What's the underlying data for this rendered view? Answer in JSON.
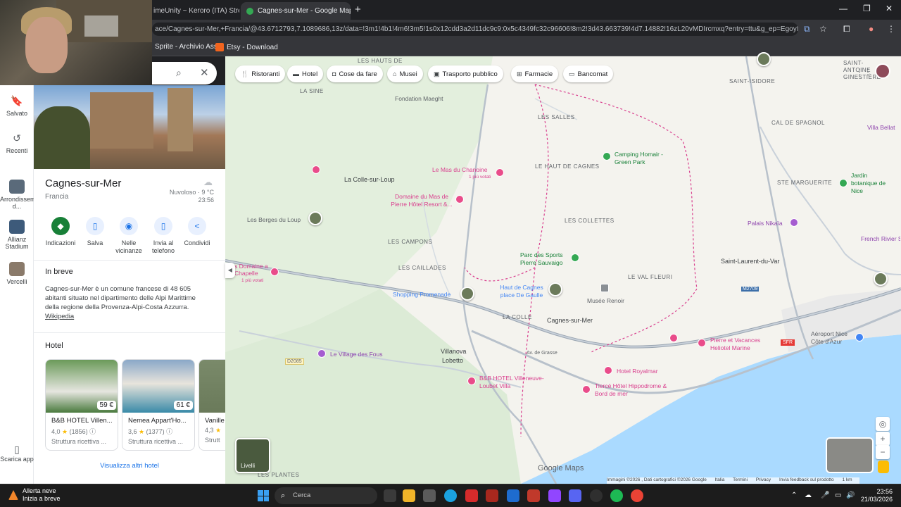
{
  "browser": {
    "tabs": [
      {
        "title": "imeUnity ~ Keroro (ITA) Strea",
        "active": false
      },
      {
        "title": "Cagnes-sur-Mer - Google Maps",
        "active": true
      }
    ],
    "url": "ace/Cagnes-sur-Mer,+Francia/@43.6712793,7.1089686,13z/data=!3m1!4b1!4m6!3m5!1s0x12cdd3a2d11dc9c9:0x5c4349fc32c96606!8m2!3d43.663739!4d7.14882!16zL20vMDIrcmxq?entry=ttu&g_ep=EgoyMDI2MDMxOC4xI...",
    "bookmarks": [
      {
        "label": "Sprite - Archivio Ass...",
        "color": "#4a4a4a"
      },
      {
        "label": "Etsy - Download",
        "color": "#f1641e"
      }
    ]
  },
  "rail": {
    "items": [
      {
        "label": "Salvato",
        "icon": "bookmark-icon"
      },
      {
        "label": "Recenti",
        "icon": "history-icon"
      }
    ],
    "recent_places": [
      {
        "label": "Arrondissement d...",
        "color": "#5a6a7a"
      },
      {
        "label": "Allianz Stadium",
        "color": "#3d5a7a"
      },
      {
        "label": "Vercelli",
        "color": "#8a7a6a"
      }
    ],
    "download": "Scarica app"
  },
  "place": {
    "name": "Cagnes-sur-Mer",
    "country": "Francia",
    "weather": "Nuvoloso · 9 °C",
    "time": "23:56",
    "actions": [
      {
        "label": "Indicazioni",
        "icon": "directions-icon"
      },
      {
        "label": "Salva",
        "icon": "bookmark-icon"
      },
      {
        "label": "Nelle vicinanze",
        "icon": "nearby-icon"
      },
      {
        "label": "Invia al telefono",
        "icon": "phone-icon"
      },
      {
        "label": "Condividi",
        "icon": "share-icon"
      }
    ],
    "brief_title": "In breve",
    "brief_text": "Cagnes-sur-Mer è un comune francese di 48 605 abitanti situato nel dipartimento delle Alpi Marittime della regione della Provenza-Alpi-Costa Azzurra.",
    "brief_link": "Wikipedia",
    "hotels_title": "Hotel",
    "hotels": [
      {
        "name": "B&B HOTEL Villen...",
        "price": "59 €",
        "rating": "4,0",
        "reviews": "(1856)",
        "kind": "Struttura ricettiva ...",
        "color": "#4a7a3e"
      },
      {
        "name": "Nemea Appart'Ho...",
        "price": "61 €",
        "rating": "3,6",
        "reviews": "(1377)",
        "kind": "Struttura ricettiva ...",
        "color": "#3a8aa8"
      },
      {
        "name": "Vanille",
        "price": "",
        "rating": "4,3",
        "reviews": "",
        "kind": "Strutt",
        "color": "#6a7a5a"
      }
    ],
    "more_hotels": "Visualizza altri hotel"
  },
  "map": {
    "chips": [
      {
        "label": "Ristoranti",
        "icon": "restaurant-icon"
      },
      {
        "label": "Hotel",
        "icon": "hotel-icon"
      },
      {
        "label": "Cose da fare",
        "icon": "camera-icon"
      },
      {
        "label": "Musei",
        "icon": "museum-icon"
      },
      {
        "label": "Trasporto pubblico",
        "icon": "transit-icon"
      },
      {
        "label": "Farmacie",
        "icon": "pharmacy-icon"
      },
      {
        "label": "Bancomat",
        "icon": "atm-icon"
      }
    ],
    "labels": {
      "la_colle": "La Colle-sur-Loup",
      "cagnes": "Cagnes-sur-Mer",
      "villanova": "Villanova",
      "lobetto": "Lobetto",
      "saint_laurent": "Saint-Laurent-du-Var",
      "les_salles": "LES SALLES",
      "haut_de_cagnes_area": "LE HAUT DE CAGNES",
      "les_collettes": "LES COLLETTES",
      "les_campons": "LES CAMPONS",
      "les_caillades": "LES CAILLADES",
      "la_colle_area": "LA COLLE",
      "le_val_fleuri": "LE VAL FLEURI",
      "la_sine": "LA SINE",
      "les_hauts": "LES HAUTS DE",
      "cal_de_spagnol": "CAL DE SPAGNOL",
      "ste_marguerite": "STE MARGUERITE",
      "saint_isidore": "SAINT-ISIDORE",
      "saint_antoine": "SAINT-ANTOINE GINESTIÈRE",
      "les_plantes": "LES PLANTES",
      "fondation": "Fondation Maeght",
      "mas_chanoine": "Le Mas du Chanoine",
      "mas_chanoine_sub": "1 più votati",
      "domaine_mas": "Domaine du Mas de Pierre Hôtel Resort &...",
      "berges": "Les Berges du Loup",
      "domaine_chapelle": "s Domaine a Chapelle",
      "domaine_chapelle_sub": "1 più votati",
      "camping": "Camping Homair - Green Park",
      "parc_sports": "Parc des Sports Pierre Sauvaigo",
      "haut_cagnes": "Haut de Cagnes place De Gaulle",
      "musee_renoir": "Musée Renoir",
      "shopping": "Shopping Promenade",
      "village_fous": "Le Village des Fous",
      "bb_hotel": "B&B HOTEL Villeneuve-Loubet Villa",
      "hotel_royalmar": "Hotel Royalmar",
      "tierce": "Tiercé Hôtel Hippodrome & Bord de mer",
      "pierre_vacances": "Pierre et Vacances Heliotel Marine",
      "aeroport": "Aéroport Nice Côte d'Azur",
      "jardin": "Jardin botanique de Nice",
      "palais": "Palais Nikaïa",
      "french_riviera": "French Rivier Sightseein",
      "villa": "Villa Bellat",
      "road_d2085": "D2085",
      "road_m2709": "M2709",
      "ave_grasse": "Av. de Grasse"
    },
    "layers": "Livelli",
    "brand": "Google Maps",
    "copyright": [
      "Immagini ©2026 , Dati cartografici ©2026 Google",
      "Italia",
      "Termini",
      "Privacy",
      "Invia feedback sul prodotto",
      "1 km"
    ]
  },
  "taskbar": {
    "weather_title": "Allerta neve",
    "weather_sub": "Inizia a breve",
    "search": "Cerca",
    "time": "23:56",
    "date": "21/03/2026"
  }
}
